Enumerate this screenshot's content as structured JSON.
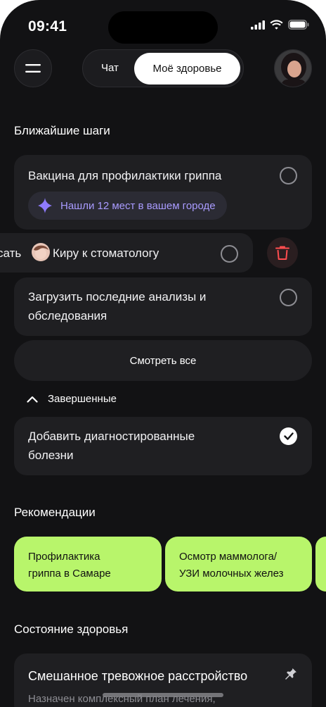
{
  "status_bar": {
    "time": "09:41"
  },
  "header": {
    "tabs": [
      {
        "label": "Чат"
      },
      {
        "label": "Моё здоровье"
      }
    ],
    "active_tab": "Моё здоровье"
  },
  "next_steps": {
    "title": "Ближайшие шаги",
    "items": [
      {
        "label": "Вакцина для профилактики гриппа",
        "hint": "Нашли 12 мест в вашем городе"
      },
      {
        "label_prefix": "сать",
        "label": "Киру к стоматологу"
      },
      {
        "label_line1": "Загрузить последние анализы и",
        "label_line2": "обследования"
      }
    ],
    "see_all_label": "Смотреть все",
    "completed_label": "Завершенные",
    "completed_items": [
      {
        "label_line1": "Добавить диагностированные",
        "label_line2": "болезни"
      }
    ]
  },
  "recommendations": {
    "title": "Рекомендации",
    "items": [
      {
        "line1": "Профилактика",
        "line2": "гриппа в Самаре"
      },
      {
        "line1": "Осмотр маммолога/",
        "line2": "УЗИ молочных желез"
      }
    ],
    "accent_color": "#b8f56b"
  },
  "health_state": {
    "title": "Состояние здоровья",
    "card_title": "Смешанное тревожное расстройство",
    "card_subtitle": "Назначен комплексный план лечения,"
  },
  "colors": {
    "background": "#121214",
    "card": "#1f1f22",
    "hint_text": "#a99bff",
    "delete": "#ff4d4f"
  }
}
